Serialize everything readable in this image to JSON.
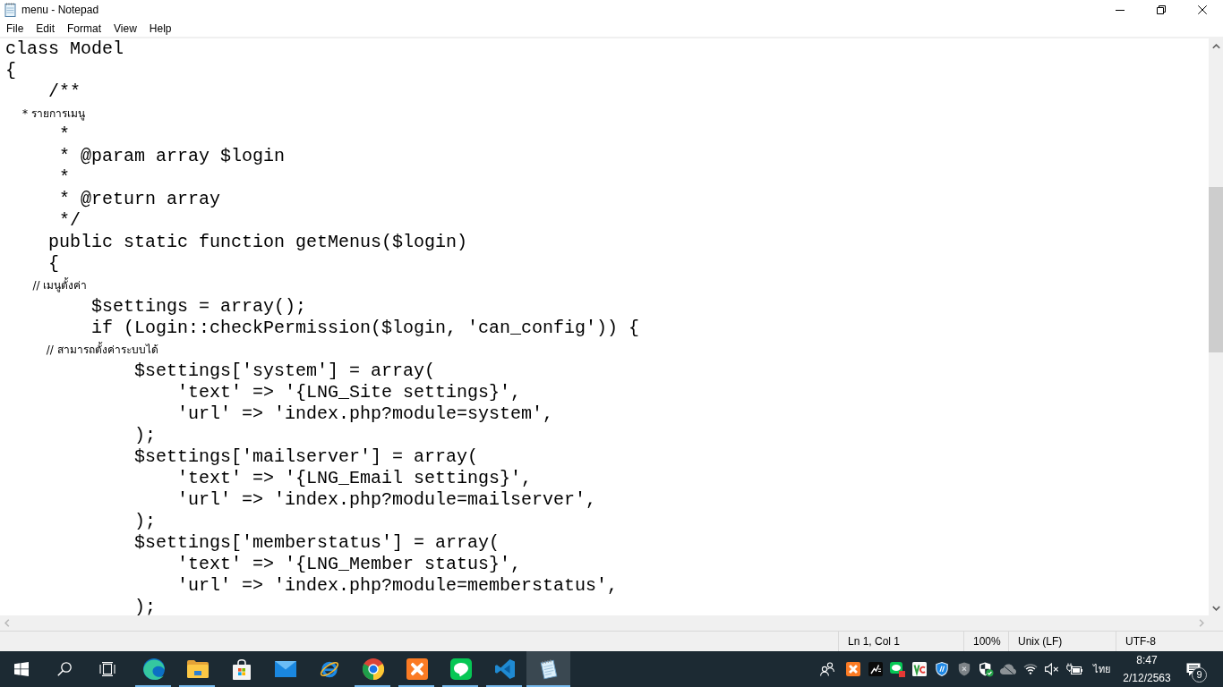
{
  "window": {
    "title": "menu - Notepad"
  },
  "menu": [
    "File",
    "Edit",
    "Format",
    "View",
    "Help"
  ],
  "editor": {
    "lines": [
      {
        "kind": "mono",
        "text": "class Model"
      },
      {
        "kind": "mono",
        "text": "{"
      },
      {
        "kind": "mono",
        "text": "    /**"
      },
      {
        "kind": "fallback",
        "text": "     * รายการเมนู"
      },
      {
        "kind": "mono",
        "text": "     *"
      },
      {
        "kind": "mono",
        "text": "     * @param array $login"
      },
      {
        "kind": "mono",
        "text": "     *"
      },
      {
        "kind": "mono",
        "text": "     * @return array"
      },
      {
        "kind": "mono",
        "text": "     */"
      },
      {
        "kind": "mono",
        "text": "    public static function getMenus($login)"
      },
      {
        "kind": "mono",
        "text": "    {"
      },
      {
        "kind": "fallback",
        "text": "        // เมนูตั้งค่า"
      },
      {
        "kind": "mono",
        "text": "        $settings = array();"
      },
      {
        "kind": "mono",
        "text": "        if (Login::checkPermission($login, 'can_config')) {"
      },
      {
        "kind": "fallback",
        "text": "            // สามารถตั้งค่าระบบได้"
      },
      {
        "kind": "mono",
        "text": "            $settings['system'] = array("
      },
      {
        "kind": "mono",
        "text": "                'text' => '{LNG_Site settings}',"
      },
      {
        "kind": "mono",
        "text": "                'url' => 'index.php?module=system',"
      },
      {
        "kind": "mono",
        "text": "            );"
      },
      {
        "kind": "mono",
        "text": "            $settings['mailserver'] = array("
      },
      {
        "kind": "mono",
        "text": "                'text' => '{LNG_Email settings}',"
      },
      {
        "kind": "mono",
        "text": "                'url' => 'index.php?module=mailserver',"
      },
      {
        "kind": "mono",
        "text": "            );"
      },
      {
        "kind": "mono",
        "text": "            $settings['memberstatus'] = array("
      },
      {
        "kind": "mono",
        "text": "                'text' => '{LNG_Member status}',"
      },
      {
        "kind": "mono",
        "text": "                'url' => 'index.php?module=memberstatus',"
      },
      {
        "kind": "mono",
        "text": "            );"
      }
    ]
  },
  "status_bar": {
    "cells": [
      "Ln 1, Col 1",
      "100%",
      "Unix (LF)",
      "UTF-8"
    ]
  },
  "taskbar": {
    "apps": [
      {
        "kind": "swirl",
        "running": true,
        "selected": false
      },
      {
        "kind": "folder",
        "running": true,
        "selected": false
      },
      {
        "kind": "bag",
        "running": false,
        "selected": false
      },
      {
        "kind": "envelope",
        "running": false,
        "selected": false
      },
      {
        "kind": "letter",
        "running": false,
        "selected": false
      },
      {
        "kind": "wheel",
        "running": true,
        "selected": false
      },
      {
        "kind": "knot",
        "running": true,
        "selected": false
      },
      {
        "kind": "bubble",
        "running": true,
        "selected": false
      },
      {
        "kind": "ribbon",
        "running": true,
        "selected": false
      },
      {
        "kind": "notepad",
        "running": true,
        "selected": true
      }
    ],
    "tray": {
      "language": "ไทย",
      "time": "8:47",
      "date": "2/12/2563",
      "notification_count": "9"
    }
  }
}
